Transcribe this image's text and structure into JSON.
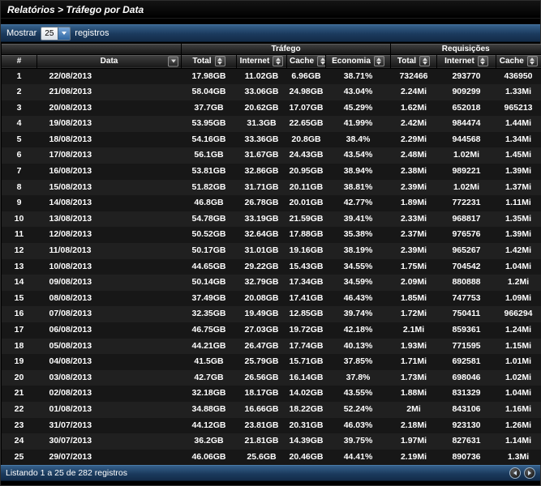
{
  "header": {
    "breadcrumb": "Relatórios > Tráfego por Data"
  },
  "toolbar": {
    "show_label": "Mostrar",
    "page_size": "25",
    "records_label": "registros"
  },
  "table": {
    "groups": [
      {
        "label": "Tráfego"
      },
      {
        "label": "Requisições"
      }
    ],
    "columns": [
      {
        "key": "index",
        "label": "#",
        "sort": "none"
      },
      {
        "key": "data",
        "label": "Data",
        "sort": "desc"
      },
      {
        "key": "trafego-total",
        "label": "Total",
        "sort": "both"
      },
      {
        "key": "trafego-internet",
        "label": "Internet",
        "sort": "both"
      },
      {
        "key": "trafego-cache",
        "label": "Cache",
        "sort": "both"
      },
      {
        "key": "economia",
        "label": "Economia",
        "sort": "both"
      },
      {
        "key": "req-total",
        "label": "Total",
        "sort": "both"
      },
      {
        "key": "req-internet",
        "label": "Internet",
        "sort": "both"
      },
      {
        "key": "req-cache",
        "label": "Cache",
        "sort": "both"
      }
    ],
    "rows": [
      [
        "1",
        "22/08/2013",
        "17.98GB",
        "11.02GB",
        "6.96GB",
        "38.71%",
        "732466",
        "293770",
        "436950"
      ],
      [
        "2",
        "21/08/2013",
        "58.04GB",
        "33.06GB",
        "24.98GB",
        "43.04%",
        "2.24Mi",
        "909299",
        "1.33Mi"
      ],
      [
        "3",
        "20/08/2013",
        "37.7GB",
        "20.62GB",
        "17.07GB",
        "45.29%",
        "1.62Mi",
        "652018",
        "965213"
      ],
      [
        "4",
        "19/08/2013",
        "53.95GB",
        "31.3GB",
        "22.65GB",
        "41.99%",
        "2.42Mi",
        "984474",
        "1.44Mi"
      ],
      [
        "5",
        "18/08/2013",
        "54.16GB",
        "33.36GB",
        "20.8GB",
        "38.4%",
        "2.29Mi",
        "944568",
        "1.34Mi"
      ],
      [
        "6",
        "17/08/2013",
        "56.1GB",
        "31.67GB",
        "24.43GB",
        "43.54%",
        "2.48Mi",
        "1.02Mi",
        "1.45Mi"
      ],
      [
        "7",
        "16/08/2013",
        "53.81GB",
        "32.86GB",
        "20.95GB",
        "38.94%",
        "2.38Mi",
        "989221",
        "1.39Mi"
      ],
      [
        "8",
        "15/08/2013",
        "51.82GB",
        "31.71GB",
        "20.11GB",
        "38.81%",
        "2.39Mi",
        "1.02Mi",
        "1.37Mi"
      ],
      [
        "9",
        "14/08/2013",
        "46.8GB",
        "26.78GB",
        "20.01GB",
        "42.77%",
        "1.89Mi",
        "772231",
        "1.11Mi"
      ],
      [
        "10",
        "13/08/2013",
        "54.78GB",
        "33.19GB",
        "21.59GB",
        "39.41%",
        "2.33Mi",
        "968817",
        "1.35Mi"
      ],
      [
        "11",
        "12/08/2013",
        "50.52GB",
        "32.64GB",
        "17.88GB",
        "35.38%",
        "2.37Mi",
        "976576",
        "1.39Mi"
      ],
      [
        "12",
        "11/08/2013",
        "50.17GB",
        "31.01GB",
        "19.16GB",
        "38.19%",
        "2.39Mi",
        "965267",
        "1.42Mi"
      ],
      [
        "13",
        "10/08/2013",
        "44.65GB",
        "29.22GB",
        "15.43GB",
        "34.55%",
        "1.75Mi",
        "704542",
        "1.04Mi"
      ],
      [
        "14",
        "09/08/2013",
        "50.14GB",
        "32.79GB",
        "17.34GB",
        "34.59%",
        "2.09Mi",
        "880888",
        "1.2Mi"
      ],
      [
        "15",
        "08/08/2013",
        "37.49GB",
        "20.08GB",
        "17.41GB",
        "46.43%",
        "1.85Mi",
        "747753",
        "1.09Mi"
      ],
      [
        "16",
        "07/08/2013",
        "32.35GB",
        "19.49GB",
        "12.85GB",
        "39.74%",
        "1.72Mi",
        "750411",
        "966294"
      ],
      [
        "17",
        "06/08/2013",
        "46.75GB",
        "27.03GB",
        "19.72GB",
        "42.18%",
        "2.1Mi",
        "859361",
        "1.24Mi"
      ],
      [
        "18",
        "05/08/2013",
        "44.21GB",
        "26.47GB",
        "17.74GB",
        "40.13%",
        "1.93Mi",
        "771595",
        "1.15Mi"
      ],
      [
        "19",
        "04/08/2013",
        "41.5GB",
        "25.79GB",
        "15.71GB",
        "37.85%",
        "1.71Mi",
        "692581",
        "1.01Mi"
      ],
      [
        "20",
        "03/08/2013",
        "42.7GB",
        "26.56GB",
        "16.14GB",
        "37.8%",
        "1.73Mi",
        "698046",
        "1.02Mi"
      ],
      [
        "21",
        "02/08/2013",
        "32.18GB",
        "18.17GB",
        "14.02GB",
        "43.55%",
        "1.88Mi",
        "831329",
        "1.04Mi"
      ],
      [
        "22",
        "01/08/2013",
        "34.88GB",
        "16.66GB",
        "18.22GB",
        "52.24%",
        "2Mi",
        "843106",
        "1.16Mi"
      ],
      [
        "23",
        "31/07/2013",
        "44.12GB",
        "23.81GB",
        "20.31GB",
        "46.03%",
        "2.18Mi",
        "923130",
        "1.26Mi"
      ],
      [
        "24",
        "30/07/2013",
        "36.2GB",
        "21.81GB",
        "14.39GB",
        "39.75%",
        "1.97Mi",
        "827631",
        "1.14Mi"
      ],
      [
        "25",
        "29/07/2013",
        "46.06GB",
        "25.6GB",
        "20.46GB",
        "44.41%",
        "2.19Mi",
        "890736",
        "1.3Mi"
      ]
    ]
  },
  "footer": {
    "status": "Listando 1 a 25 de 282 registros"
  },
  "colors": {
    "accent_blue": "#1b3a5d",
    "header_gray": "#2f2f2f",
    "row_odd": "#171717",
    "row_even": "#202020"
  }
}
